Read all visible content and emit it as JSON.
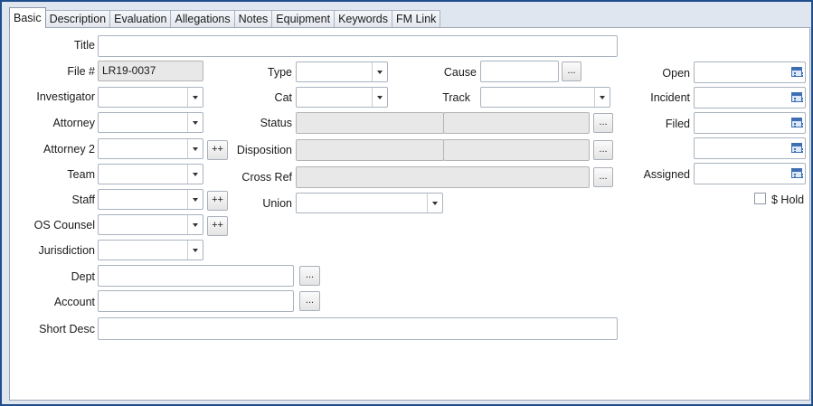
{
  "tabs": [
    {
      "label": "Basic",
      "active": true
    },
    {
      "label": "Description"
    },
    {
      "label": "Evaluation"
    },
    {
      "label": "Allegations"
    },
    {
      "label": "Notes"
    },
    {
      "label": "Equipment"
    },
    {
      "label": "Keywords"
    },
    {
      "label": "FM Link"
    }
  ],
  "form": {
    "title_label": "Title",
    "file_label": "File #",
    "file_value": "LR19-0037",
    "investigator_label": "Investigator",
    "attorney_label": "Attorney",
    "attorney2_label": "Attorney 2",
    "team_label": "Team",
    "staff_label": "Staff",
    "os_counsel_label": "OS Counsel",
    "jurisdiction_label": "Jurisdiction",
    "dept_label": "Dept",
    "account_label": "Account",
    "short_desc_label": "Short Desc",
    "type_label": "Type",
    "cat_label": "Cat",
    "status_label": "Status",
    "disposition_label": "Disposition",
    "cross_ref_label": "Cross Ref",
    "union_label": "Union",
    "cause_label": "Cause",
    "track_label": "Track",
    "open_label": "Open",
    "incident_label": "Incident",
    "filed_label": "Filed",
    "assigned_label": "Assigned",
    "hold_label": "$ Hold",
    "ellipsis": "...",
    "add_more": "++"
  }
}
